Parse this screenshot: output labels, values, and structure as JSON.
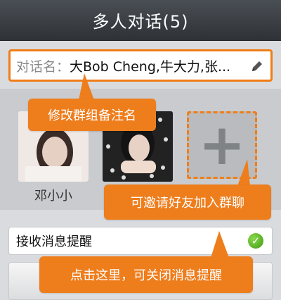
{
  "header": {
    "title": "多人对话(5)"
  },
  "group_name": {
    "label": "对话名：",
    "value": "大Bob Cheng,牛大力,张..."
  },
  "members": [
    {
      "name": "邓小小"
    },
    {
      "name": ""
    }
  ],
  "add_member": {
    "icon": "plus-icon"
  },
  "notify": {
    "label": "接收消息提醒",
    "enabled": true
  },
  "callouts": {
    "rename": "修改群组备注名",
    "invite": "可邀请好友加入群聊",
    "notify_off": "点击这里，可关闭消息提醒"
  },
  "colors": {
    "accent": "#f07d16",
    "callout": "#ee7d1c",
    "check": "#4caf1f"
  }
}
